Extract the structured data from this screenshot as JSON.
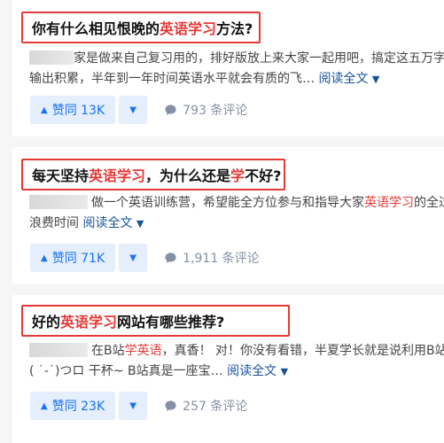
{
  "items": [
    {
      "title_pre": "你有什么相见恨晚的",
      "title_hl": "英语学习",
      "title_post": "方法?",
      "excerpt_line1_pre": "",
      "excerpt_line1_hl": "",
      "excerpt_line1": "家是做来自己复习用的，排好版放上来大家一起用吧，搞定这五万字",
      "excerpt_line2": "输出积累，半年到一年时间英语水平就会有质的飞…",
      "read_more": "阅读全文",
      "vote_label": "赞同 13K",
      "comments": "793 条评论"
    },
    {
      "title_pre": "每天坚持",
      "title_hl": "英语学习",
      "title_mid": "，为什么还是",
      "title_hl2": "学",
      "title_post": "不好?",
      "excerpt_line1": "做一个英语训练营，希望能全方位参与和指导大家",
      "excerpt_line1_hl": "英语学习",
      "excerpt_line1_post": "的全过",
      "excerpt_line2": "浪费时间",
      "read_more": "阅读全文",
      "vote_label": "赞同 71K",
      "comments": "1,911 条评论"
    },
    {
      "title_pre": "好的",
      "title_hl": "英语学习",
      "title_post": "网站有哪些推荐?",
      "excerpt_line1_pre": "在B站",
      "excerpt_line1_hl": "学英语",
      "excerpt_line1": "，真香！ 对！你没有看错，半夏学长就是说利用B站",
      "excerpt_line2": "( ˙-˙)つロ 干杯~ B站真是一座宝…",
      "read_more": "阅读全文",
      "vote_label": "赞同 23K",
      "comments": "257 条评论"
    }
  ],
  "icons": {
    "upvote": "triangle-up-icon",
    "downvote": "triangle-down-icon",
    "comment": "speech-bubble-icon",
    "expand": "chevron-down-icon"
  },
  "colors": {
    "highlight": "#e53935",
    "link": "#175199",
    "vote_bg": "#e5eefc",
    "vote_text": "#1772f6"
  }
}
